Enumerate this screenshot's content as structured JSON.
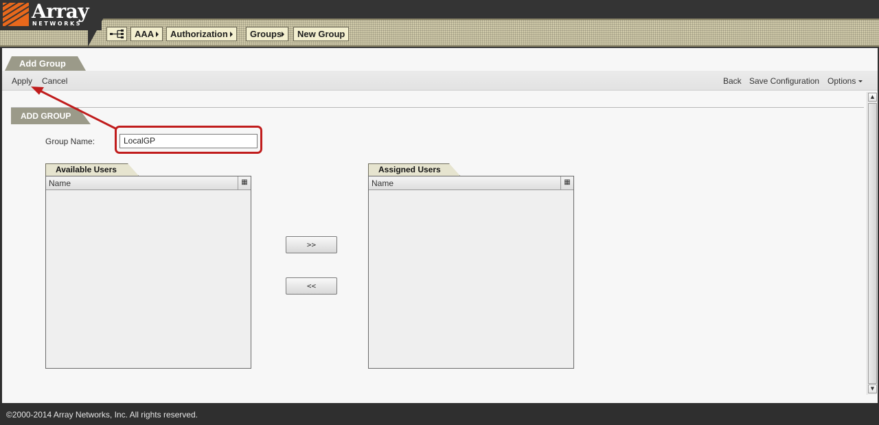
{
  "logo": {
    "brand": "Array",
    "sub": "NETWORKS"
  },
  "breadcrumb": [
    {
      "label": "AAA"
    },
    {
      "label": "Authorization"
    },
    {
      "label": "Groups"
    },
    {
      "label": "New Group"
    }
  ],
  "page_tab": "Add Group",
  "toolbar": {
    "apply": "Apply",
    "cancel": "Cancel",
    "back": "Back",
    "save_configuration": "Save Configuration",
    "options": "Options"
  },
  "section": {
    "title": "ADD GROUP",
    "group_name_label": "Group Name:",
    "group_name_value": "LocalGP"
  },
  "available_users": {
    "tab": "Available Users",
    "column": "Name",
    "rows": []
  },
  "assigned_users": {
    "tab": "Assigned Users",
    "column": "Name",
    "rows": []
  },
  "buttons": {
    "add": ">>",
    "remove": "<<"
  },
  "annotation": {
    "highlight_color": "#c01c1c"
  },
  "colors": {
    "brand_orange": "#e8681c",
    "tab_gray": "#9b9a89",
    "crumb_bg": "#f3efcf"
  },
  "icons": {
    "nav": "network-nav-icon",
    "column_chooser": "column-chooser-icon"
  },
  "footer": "©2000-2014 Array Networks, Inc. All rights reserved."
}
